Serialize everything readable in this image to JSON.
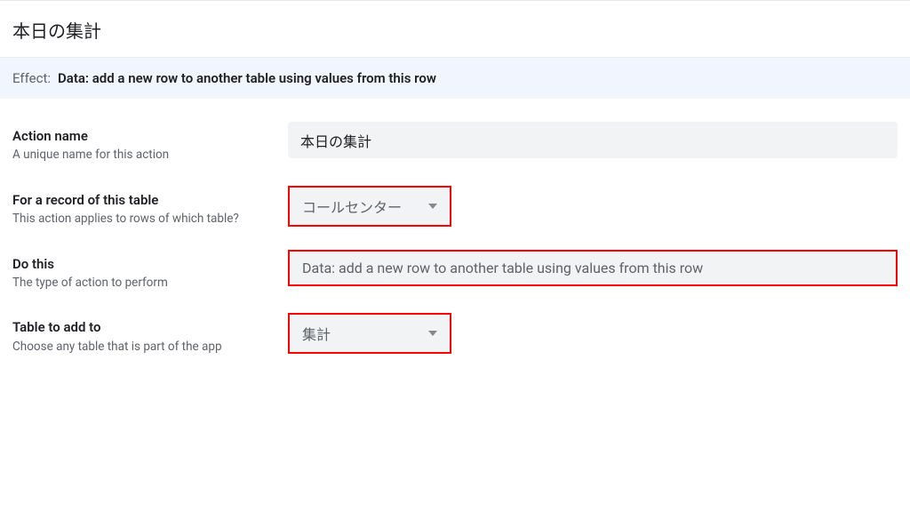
{
  "page_title": "本日の集計",
  "effect": {
    "label": "Effect:",
    "value": "Data: add a new row to another table using values from this row"
  },
  "fields": {
    "action_name": {
      "title": "Action name",
      "desc": "A unique name for this action",
      "value": "本日の集計"
    },
    "for_record": {
      "title": "For a record of this table",
      "desc": "This action applies to rows of which table?",
      "value": "コールセンター"
    },
    "do_this": {
      "title": "Do this",
      "desc": "The type of action to perform",
      "value": "Data: add a new row to another table using values from this row"
    },
    "table_to_add": {
      "title": "Table to add to",
      "desc": "Choose any table that is part of the app",
      "value": "集計"
    }
  }
}
